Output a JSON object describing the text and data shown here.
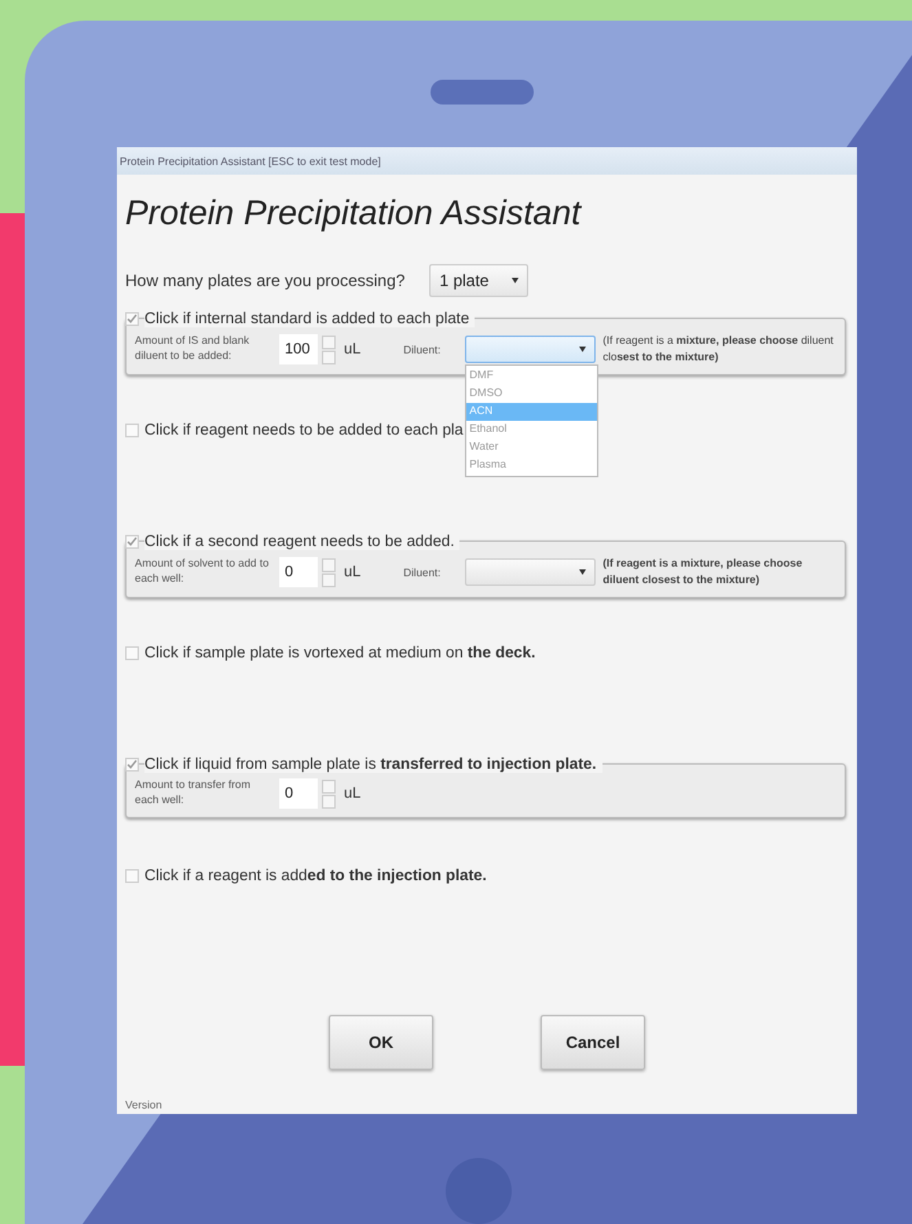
{
  "window": {
    "title": "Protein Precipitation Assistant [ESC to exit test mode]"
  },
  "heading": "Protein Precipitation Assistant",
  "plates": {
    "label": "How many plates are you processing?",
    "value": "1 plate"
  },
  "sections": [
    {
      "kind": "group",
      "checked": true,
      "label": "Click if internal standard is added to each plate",
      "amount_label": "Amount of IS and blank diluent to be added:",
      "amount": "100",
      "unit": "uL",
      "diluent_label": "Diluent:",
      "expanded": true,
      "options": [
        {
          "label": "DMF",
          "selected": false
        },
        {
          "label": "DMSO",
          "selected": false
        },
        {
          "label": "ACN",
          "selected": true
        },
        {
          "label": "Ethanol",
          "selected": false
        },
        {
          "label": "Water",
          "selected": false
        },
        {
          "label": "Plasma",
          "selected": false
        }
      ],
      "note": "(If reagent is a **mixture, please choose** diluent clo**sest to the mixture)**"
    },
    {
      "kind": "check",
      "checked": false,
      "label": "Click if reagent needs to be added to each pla"
    },
    {
      "kind": "group",
      "checked": true,
      "label": "Click if a second reagent needs to be added.",
      "amount_label": "Amount of solvent to add to each well:",
      "amount": "0",
      "unit": "uL",
      "diluent_label": "Diluent:",
      "expanded": false,
      "note": "**(If reagent is a mixture, please choose diluent closest to the mixture)**"
    },
    {
      "kind": "check",
      "checked": false,
      "label": "Click if sample plate is vortexed at medium on **the deck.**"
    },
    {
      "kind": "group",
      "checked": true,
      "label": "Click if liquid from sample plate is **transferred to injection plate.**",
      "amount_label": "Amount to transfer from each well:",
      "amount": "0",
      "unit": "uL"
    },
    {
      "kind": "check",
      "checked": false,
      "label": "Click if a reagent is add**ed to the injection plate.**"
    }
  ],
  "buttons": [
    "OK",
    "Cancel"
  ],
  "version": "Version"
}
